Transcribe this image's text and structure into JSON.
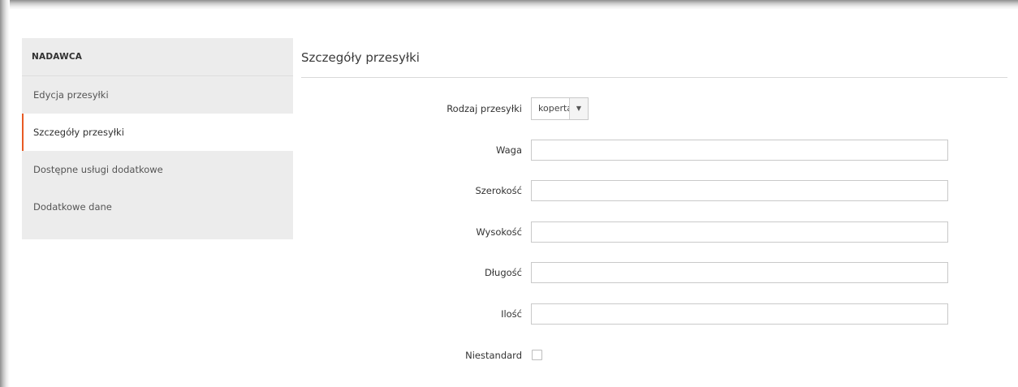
{
  "sidebar": {
    "header": "NADAWCA",
    "items": [
      {
        "label": "Edycja przesyłki"
      },
      {
        "label": "Szczegóły przesyłki",
        "active": true
      },
      {
        "label": "Dostępne usługi dodatkowe"
      },
      {
        "label": "Dodatkowe dane"
      }
    ]
  },
  "main": {
    "title": "Szczegóły przesyłki",
    "fields": {
      "shipment_type": {
        "label": "Rodzaj przesyłki",
        "value": "koperta"
      },
      "weight": {
        "label": "Waga",
        "value": ""
      },
      "width": {
        "label": "Szerokość",
        "value": ""
      },
      "height": {
        "label": "Wysokość",
        "value": ""
      },
      "length": {
        "label": "Długość",
        "value": ""
      },
      "quantity": {
        "label": "Ilość",
        "value": ""
      },
      "nonstandard": {
        "label": "Niestandard",
        "checked": false
      }
    }
  },
  "colors": {
    "accent": "#e85a24",
    "sidebar_bg": "#ececec"
  }
}
